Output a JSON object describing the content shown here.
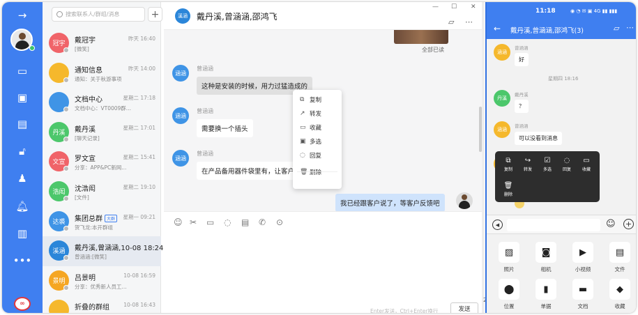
{
  "nav": {
    "collapse_icon": "arrow-right-icon",
    "items": [
      "chat-icon",
      "contacts-icon",
      "folder-icon",
      "lock-icon",
      "user-stamp-icon",
      "bell-icon",
      "document-icon",
      "more-icon"
    ]
  },
  "contacts": {
    "search_placeholder": "搜索联系人/群组/消息",
    "add_label": "+",
    "items": [
      {
        "avatar": "冠宇",
        "color": "#f06469",
        "name": "戴冠宇",
        "time": "昨天 16:40",
        "preview": "[微笑]"
      },
      {
        "avatar": "",
        "color": "#f5b82c",
        "name": "通知信息",
        "time": "昨天 14:00",
        "preview": "通知：关于秋游事项"
      },
      {
        "avatar": "",
        "color": "#3f94e6",
        "name": "文档中心",
        "time": "星期二 17:18",
        "preview": "文档中心：VT0009群..."
      },
      {
        "avatar": "丹溪",
        "color": "#4cc76b",
        "name": "戴丹溪",
        "time": "星期二 17:01",
        "preview": "[聊天记录]"
      },
      {
        "avatar": "文宣",
        "color": "#f06469",
        "name": "罗文宣",
        "time": "星期二 15:41",
        "preview": "分享：APP&PC新网..."
      },
      {
        "avatar": "浩闳",
        "color": "#4cc76b",
        "name": "沈浩闳",
        "time": "星期二 19:10",
        "preview": "[文件]"
      },
      {
        "avatar": "达裘",
        "color": "#3f94e6",
        "name": "集团总群",
        "tag": "大群",
        "time": "星期一 09:21",
        "preview": "贺飞龙:本开群组"
      },
      {
        "avatar": "溪涵",
        "color": "#2b86d9",
        "name": "戴丹溪,曾涵涵,10-08 18:24",
        "time": "",
        "preview": "曾涵涵:[微笑]"
      },
      {
        "avatar": "景明",
        "color": "#f5a623",
        "name": "吕景明",
        "time": "10-08 16:59",
        "preview": "分享：优秀新人员工..."
      },
      {
        "avatar": "",
        "color": "#f5b82c",
        "name": "折叠的群组",
        "time": "10-08 16:43",
        "preview": ""
      }
    ]
  },
  "chat": {
    "title": "戴丹溪,曾涵涵,邵鸿飞",
    "group_avatar": "溪涵",
    "read_status": "全部已读",
    "messages": [
      {
        "sender": "曾涵涵",
        "avatar": "涵涵",
        "text": "这种是安装的时候，用力过猛造成的",
        "selected": true
      },
      {
        "sender": "曾涵涵",
        "avatar": "涵涵",
        "text": "需要换一个插头",
        "selected": false
      },
      {
        "sender": "曾涵涵",
        "avatar": "涵涵",
        "text": "在产品备用器件袋里有，让客户",
        "selected": false
      }
    ],
    "my_message": "我已经跟客户说了，等客户反馈吧",
    "context_menu": [
      {
        "label": "复制",
        "icon": "copy-icon"
      },
      {
        "label": "转发",
        "icon": "forward-icon"
      },
      {
        "label": "收藏",
        "icon": "bookmark-icon"
      },
      {
        "label": "多选",
        "icon": "multiselect-icon"
      },
      {
        "label": "回复",
        "icon": "reply-icon"
      },
      {
        "label": "删除",
        "icon": "delete-icon"
      }
    ],
    "toolbar": [
      "emoji-icon",
      "scissors-icon",
      "folder-icon",
      "chat-bubble-icon",
      "note-icon",
      "phone-icon",
      "more-dots-icon"
    ],
    "hint": "Enter发送，Ctrl+Enter换行",
    "send_label": "发送",
    "row_number": "2"
  },
  "phone": {
    "time": "11:18",
    "status_icons": "◉ ◔ ✉ ▣ 4G ▮▮ ▮▮▮",
    "title": "戴丹溪,曾涵涵,邵鸿飞(3)",
    "msg1_sender": "曾涵涵",
    "msg1": "好",
    "timestamp": "星期四 18:16",
    "msg2_sender": "戴丹溪",
    "msg2": "？",
    "msg3_sender": "曾涵涵",
    "msg3": "可以没看到消息",
    "avatar1": "涵涵",
    "avatar2": "丹溪",
    "menu": [
      {
        "label": "复制",
        "icon": "copy-icon"
      },
      {
        "label": "转发",
        "icon": "forward-icon"
      },
      {
        "label": "多选",
        "icon": "multiselect-icon"
      },
      {
        "label": "回复",
        "icon": "reply-icon"
      },
      {
        "label": "收藏",
        "icon": "bookmark-icon"
      },
      {
        "label": "删除",
        "icon": "delete-icon"
      }
    ],
    "grid": [
      {
        "label": "照片",
        "icon": "photo-icon"
      },
      {
        "label": "相机",
        "icon": "camera-icon"
      },
      {
        "label": "小视频",
        "icon": "video-icon"
      },
      {
        "label": "文件",
        "icon": "file-icon"
      },
      {
        "label": "位置",
        "icon": "location-icon"
      },
      {
        "label": "单据",
        "icon": "clipboard-icon"
      },
      {
        "label": "文档",
        "icon": "folder-icon"
      },
      {
        "label": "收藏",
        "icon": "box-icon"
      }
    ]
  }
}
